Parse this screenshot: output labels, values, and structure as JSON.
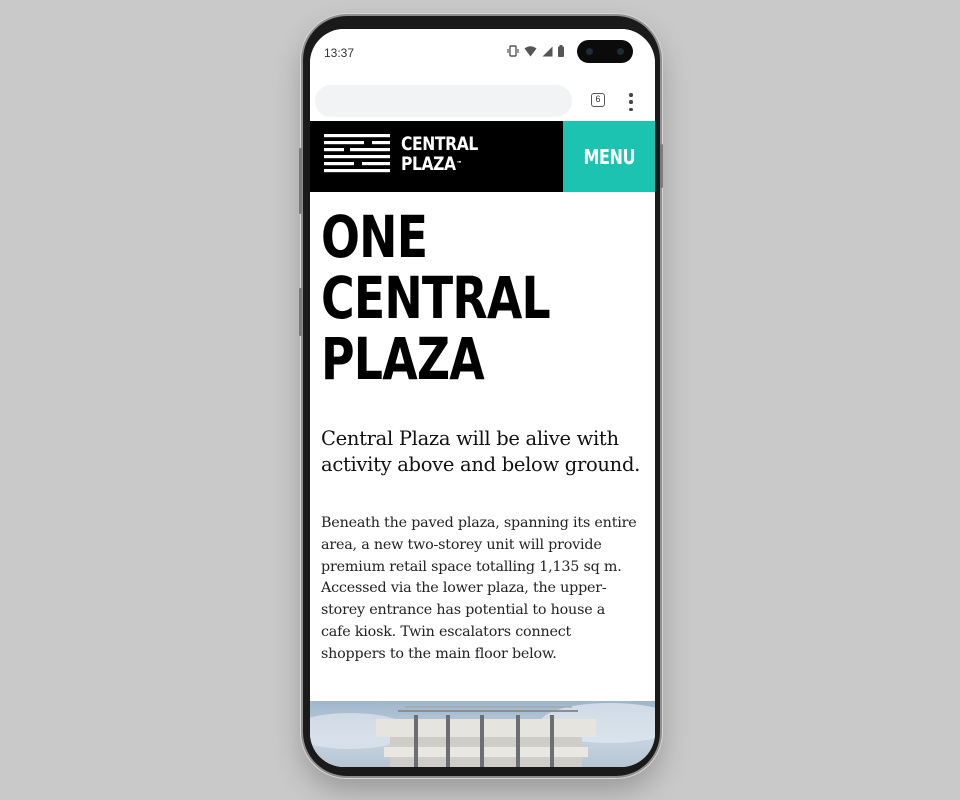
{
  "status_bar": {
    "time": "13:37"
  },
  "browser": {
    "url_value": "",
    "tab_count": "6"
  },
  "header": {
    "logo_line1": "CENTRAL",
    "logo_line2": "PLAZA",
    "logo_tm": "™",
    "menu_label": "MENU",
    "accent_color": "#1dc3b1"
  },
  "content": {
    "title_lines": [
      "ONE",
      "CENTRAL",
      "PLAZA"
    ],
    "lead": "Central Plaza will be alive with activity above and below ground.",
    "body": "Beneath the paved plaza, spanning its entire area, a new two-storey unit will provide premium retail space totalling 1,135 sq m. Accessed via the lower plaza, the upper-storey entrance has potential to house a cafe kiosk. Twin escalators connect shoppers to the main floor below."
  },
  "icons": {
    "status": [
      "vibrate-icon",
      "wifi-icon",
      "signal-icon",
      "battery-icon"
    ],
    "browser": [
      "tab-switcher-icon",
      "more-options-icon"
    ]
  }
}
